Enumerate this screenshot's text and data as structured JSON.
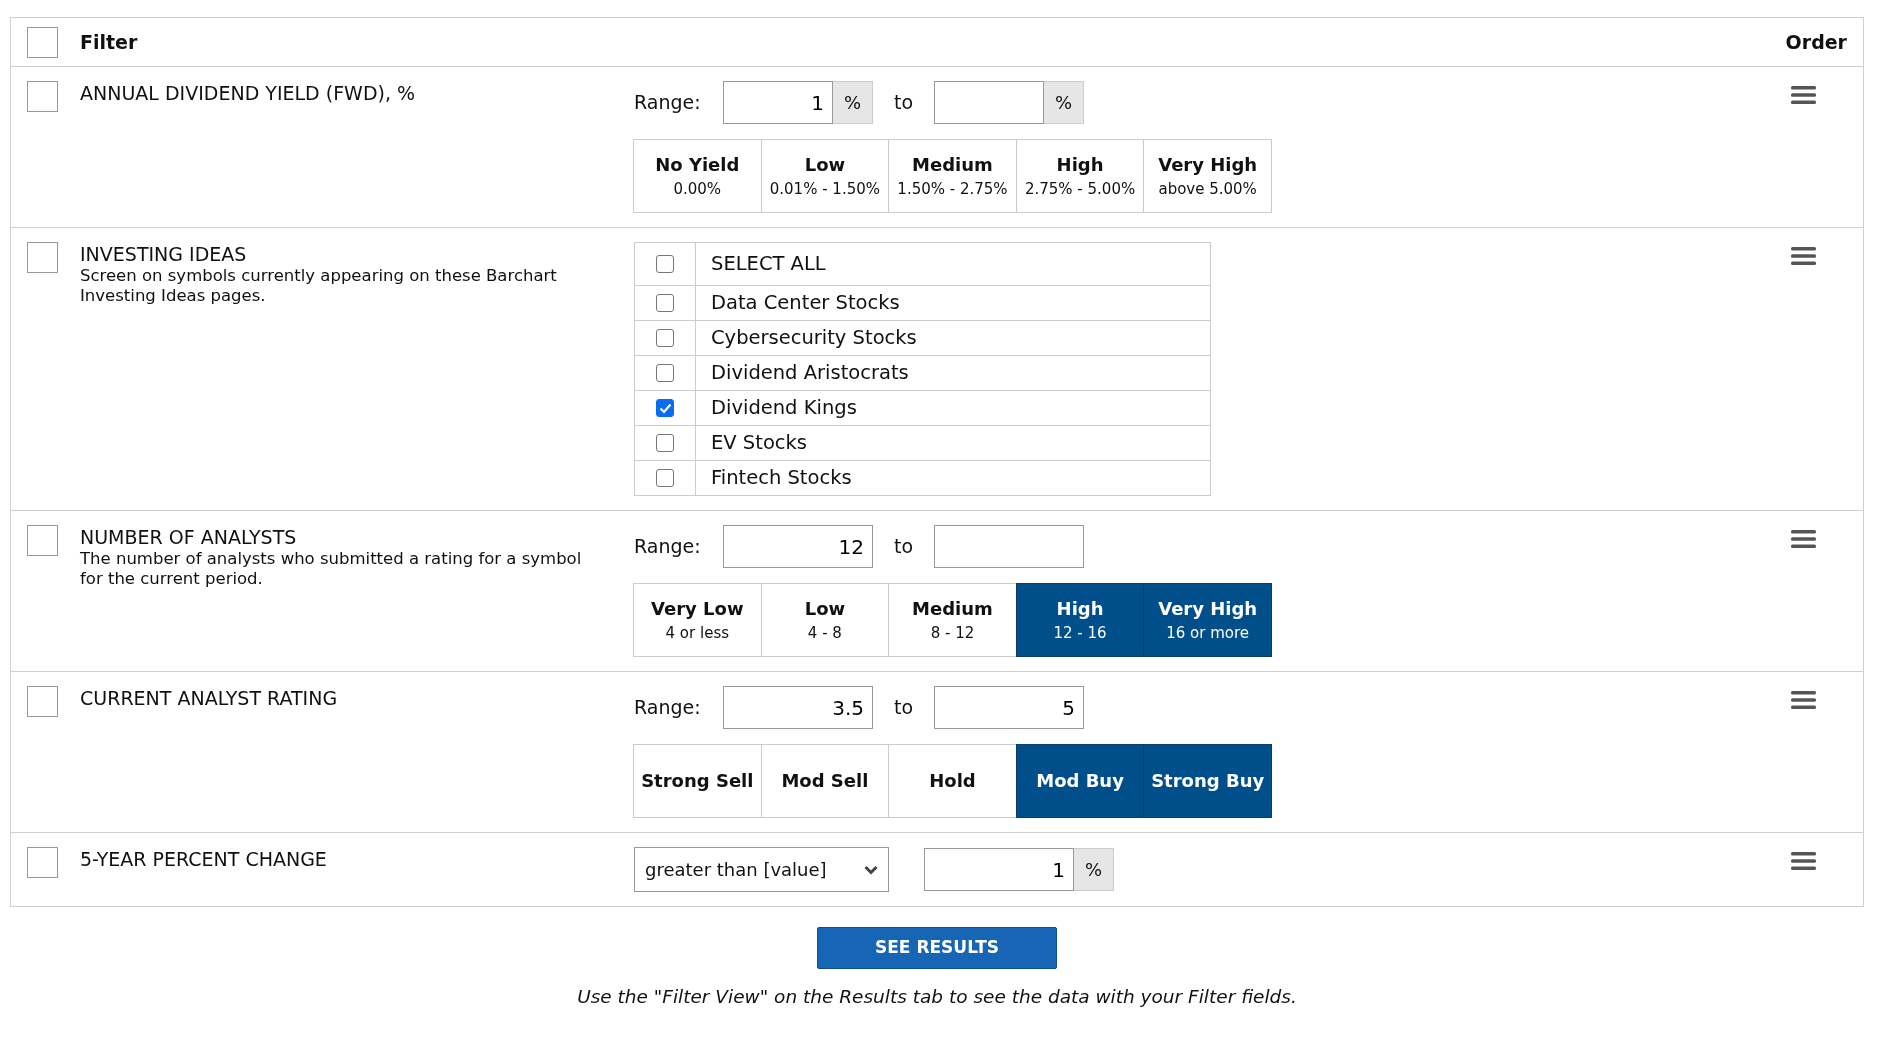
{
  "header": {
    "checked": false,
    "filter_label": "Filter",
    "order_label": "Order"
  },
  "filters": [
    {
      "kind": "range",
      "checked": false,
      "title": "ANNUAL DIVIDEND YIELD (FWD), %",
      "range": {
        "label": "Range:",
        "from": "1",
        "from_unit": "%",
        "to_word": "to",
        "to_unit": "%"
      },
      "presets": [
        {
          "label": "No Yield",
          "sub": "0.00%",
          "selected": false
        },
        {
          "label": "Low",
          "sub": "0.01% - 1.50%",
          "selected": false
        },
        {
          "label": "Medium",
          "sub": "1.50% - 2.75%",
          "selected": false
        },
        {
          "label": "High",
          "sub": "2.75% - 5.00%",
          "selected": false
        },
        {
          "label": "Very High",
          "sub": "above 5.00%",
          "selected": false
        }
      ]
    },
    {
      "kind": "list",
      "checked": false,
      "title": "INVESTING IDEAS",
      "description": "Screen on symbols currently appearing on these Barchart Investing Ideas pages.",
      "select_all": {
        "label": "SELECT ALL",
        "checked": false
      },
      "options": [
        {
          "label": "Data Center Stocks",
          "checked": false
        },
        {
          "label": "Cybersecurity Stocks",
          "checked": false
        },
        {
          "label": "Dividend Aristocrats",
          "checked": false
        },
        {
          "label": "Dividend Kings",
          "checked": true
        },
        {
          "label": "EV Stocks",
          "checked": false
        },
        {
          "label": "Fintech Stocks",
          "checked": false
        }
      ]
    },
    {
      "kind": "range",
      "checked": false,
      "title": "NUMBER OF ANALYSTS",
      "description": "The number of analysts who submitted a rating for a symbol for the current period.",
      "range": {
        "label": "Range:",
        "from": "12",
        "to_word": "to"
      },
      "presets": [
        {
          "label": "Very Low",
          "sub": "4 or less",
          "selected": false
        },
        {
          "label": "Low",
          "sub": "4 - 8",
          "selected": false
        },
        {
          "label": "Medium",
          "sub": "8 - 12",
          "selected": false
        },
        {
          "label": "High",
          "sub": "12 - 16",
          "selected": true
        },
        {
          "label": "Very High",
          "sub": "16 or more",
          "selected": true
        }
      ]
    },
    {
      "kind": "range",
      "checked": false,
      "title": "CURRENT ANALYST RATING",
      "range": {
        "label": "Range:",
        "from": "3.5",
        "to_word": "to",
        "to": "5"
      },
      "presets": [
        {
          "label": "Strong Sell",
          "selected": false
        },
        {
          "label": "Mod Sell",
          "selected": false
        },
        {
          "label": "Hold",
          "selected": false
        },
        {
          "label": "Mod Buy",
          "selected": true
        },
        {
          "label": "Strong Buy",
          "selected": true
        }
      ]
    },
    {
      "kind": "comparison",
      "checked": false,
      "title": "5-YEAR PERCENT CHANGE",
      "select": "greater than [value]",
      "value": "1",
      "unit": "%"
    }
  ],
  "button": "SEE RESULTS",
  "note": "Use the \"Filter View\" on the Results tab to see the data with your Filter fields."
}
